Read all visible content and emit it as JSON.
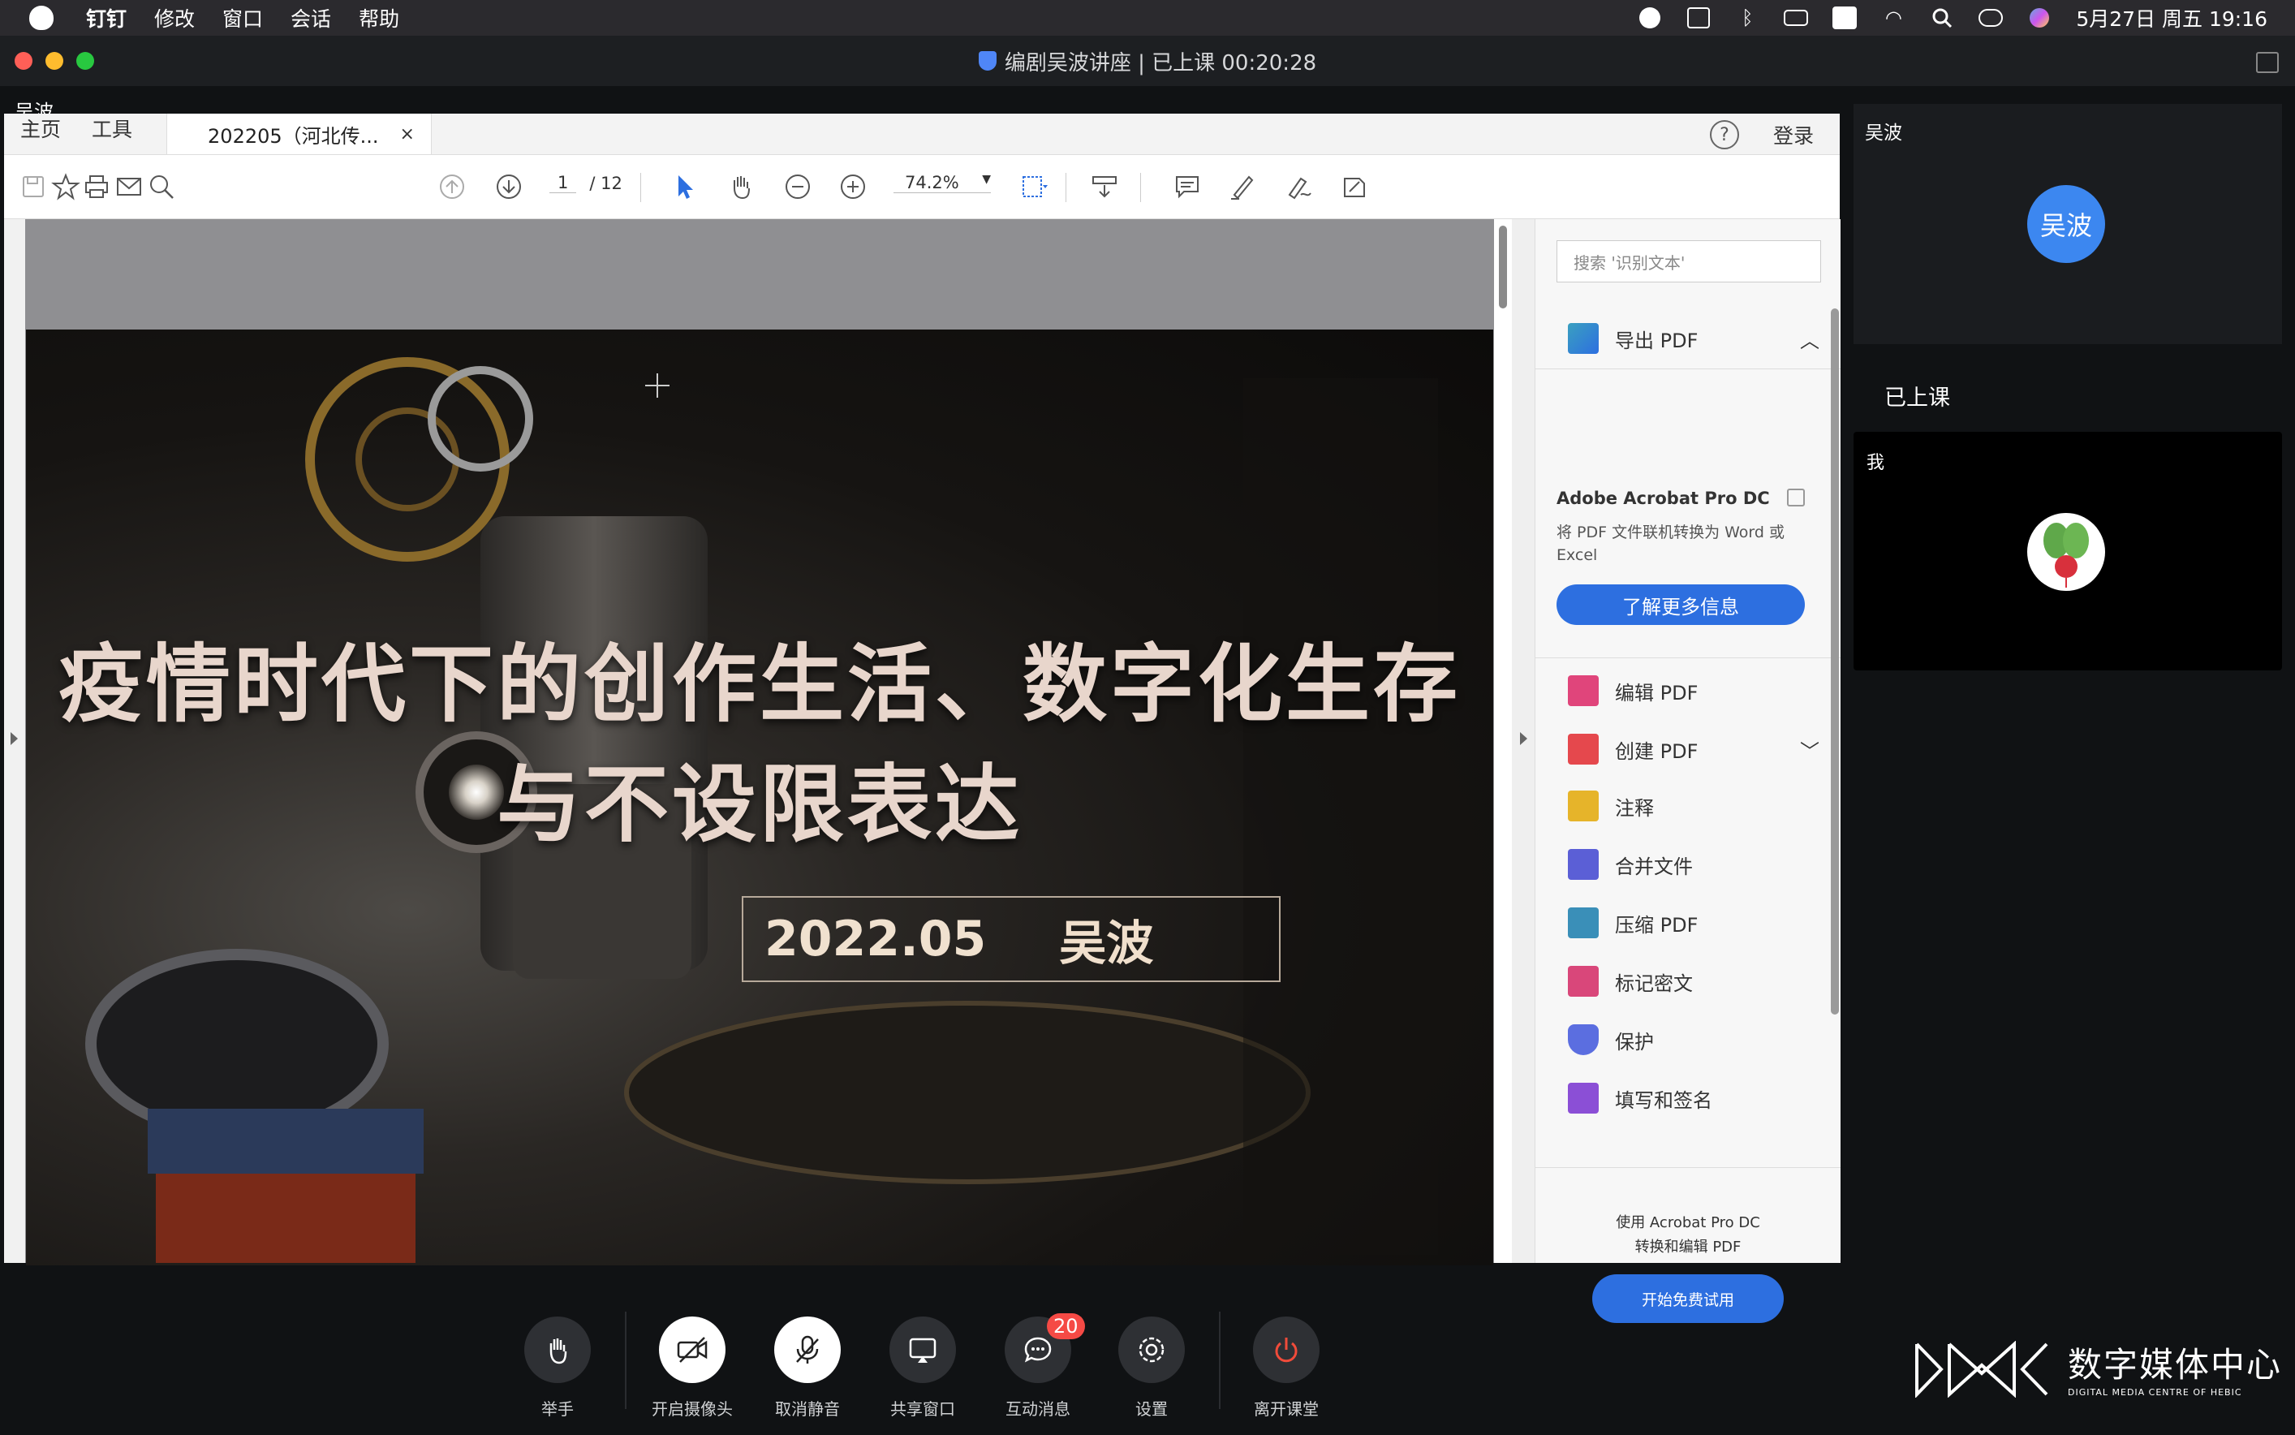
{
  "menubar": {
    "app": "钉钉",
    "items": [
      "修改",
      "窗口",
      "会话",
      "帮助"
    ],
    "datetime": "5月27日 周五  19:16"
  },
  "window": {
    "title": "编剧吴波讲座 | 已上课 00:20:28",
    "presenter_label": "吴波"
  },
  "acrobat": {
    "tabs": {
      "home": "主页",
      "tools": "工具",
      "doc": "202205（河北传...",
      "close": "×"
    },
    "help": "?",
    "login": "登录",
    "page_current": "1",
    "page_total": "/ 12",
    "zoom": "74.2%",
    "slide": {
      "title_line1": "疫情时代下的创作生活、数字化生存",
      "title_line2": "与不设限表达",
      "date": "2022.05",
      "author": "吴波"
    },
    "pane": {
      "search_placeholder": "搜索 '识别文本'",
      "export": "导出 PDF",
      "promo_title": "Adobe Acrobat Pro DC",
      "promo_desc": "将 PDF 文件联机转换为 Word 或 Excel",
      "promo_button": "了解更多信息",
      "tools": [
        "编辑 PDF",
        "创建 PDF",
        "注释",
        "合并文件",
        "压缩 PDF",
        "标记密文",
        "保护",
        "填写和签名"
      ],
      "trial_text_1": "使用 Acrobat Pro DC",
      "trial_text_2": "转换和编辑 PDF",
      "trial_button": "开始免费试用"
    }
  },
  "side": {
    "host_name": "吴波",
    "host_avatar": "吴波",
    "status": "已上课",
    "me_label": "我"
  },
  "controls": {
    "raise_hand": "举手",
    "camera": "开启摄像头",
    "mute": "取消静音",
    "share": "共享窗口",
    "messages": "互动消息",
    "messages_badge": "20",
    "settings": "设置",
    "leave": "离开课堂"
  },
  "logo": {
    "cn": "数字媒体中心",
    "en": "DIGITAL MEDIA CENTRE OF HEBIC"
  },
  "colors": {
    "accent": "#2d6fe0",
    "avatar": "#3c87f0",
    "leave": "#f04b3a",
    "badge": "#f54a45"
  }
}
